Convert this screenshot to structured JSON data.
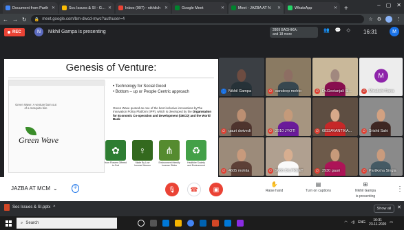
{
  "browser": {
    "tabs": [
      {
        "label": "Document from Parth",
        "color": "#4285f4",
        "active": false
      },
      {
        "label": "Soc Issues & SI - Goog",
        "color": "#fbbc04",
        "active": false
      },
      {
        "label": "Inbox (997) - nikhilch",
        "color": "#ea4335",
        "active": false
      },
      {
        "label": "Google Meet",
        "color": "#00832d",
        "active": false
      },
      {
        "label": "Meet - JAZBA AT N",
        "color": "#00832d",
        "active": true
      },
      {
        "label": "WhatsApp",
        "color": "#25d366",
        "active": false
      }
    ],
    "new_tab": "+",
    "url": "meet.google.com/bm-dwcd-mwc?authuser=4"
  },
  "meet_header": {
    "rec_label": "REC",
    "presenter_initial": "N",
    "presenter_text": "Nikhil Gampa is presenting",
    "notify_line1": "2809 BAGHIKA:",
    "notify_line2": "and 18 more",
    "clock": "16:31",
    "me_initial": "M"
  },
  "slide": {
    "title": "Genesis of Venture:",
    "leaflet_tagline": "Green Wave: A venture born out of a mosquito bite",
    "leaflet_logo": "Green Wave",
    "bullets": [
      "Technology for Social Good",
      "Bottom – up or People Centric approach"
    ],
    "paragraph_pre": "Green Wave quoted as one of the best inclusive innovations byThe Innovation Policy Platform (IPP), which is developed by the ",
    "paragraph_bold": "Organisation for Economic Co-operation and Development (OECD) and the World Bank",
    "icons": [
      {
        "caption": "from Flowers Offered to God",
        "color": "#2e7d32",
        "glyph": "✿"
      },
      {
        "caption": "Made By Low Income Women",
        "color": "#33691e",
        "glyph": "♀"
      },
      {
        "caption": "Environment friendly Incense Sticks",
        "color": "#558b2f",
        "glyph": "⋔"
      },
      {
        "caption": "Healthier Society and Environment",
        "color": "#43a047",
        "glyph": "♻"
      }
    ]
  },
  "participants": [
    {
      "name": "Nikhil Gampa",
      "mic": "on",
      "bg": "#3b3f44",
      "skin": "#6d4c41",
      "cloth": "#263238"
    },
    {
      "name": "sandeep mehto",
      "mic": "off",
      "bg": "#8a7a62",
      "skin": "#8d6e63",
      "cloth": "#37474f"
    },
    {
      "name": "Dr.Geetanjali Si...",
      "mic": "off",
      "bg": "#c9b89a",
      "skin": "#a1887f",
      "cloth": "#880e4f"
    },
    {
      "name": "Minakshi Rana",
      "mic": "off",
      "bg": "#ededed",
      "avatar": "M"
    },
    {
      "name": "gauri dwivedi",
      "mic": "off",
      "bg": "#7d6b5d",
      "skin": "#bc8f72",
      "cloth": "#4e342e"
    },
    {
      "name": "2910 JYOTI",
      "mic": "off",
      "bg": "#a69580",
      "skin": "#c49a7a",
      "cloth": "#6a1b9a"
    },
    {
      "name": "6833AVANTIKA...",
      "mic": "off",
      "bg": "#5e4e42",
      "skin": "#d7a98a",
      "cloth": "#c62828"
    },
    {
      "name": "Srishti Sahi",
      "mic": "off",
      "bg": "#8c8c8c",
      "skin": "#d2a181",
      "cloth": "#3e2723"
    },
    {
      "name": "4605 mohita",
      "mic": "off",
      "bg": "#9c8b7a",
      "skin": "#c89a7c",
      "cloth": "#5d4037"
    },
    {
      "name": "9666 DILPREET",
      "mic": "off",
      "bg": "#b0a090",
      "skin": "#d7ae90",
      "cloth": "#fafafa"
    },
    {
      "name": "2930 gauri",
      "mic": "off",
      "bg": "#6d5a4a",
      "skin": "#c79a7a",
      "cloth": "#ad1457"
    },
    {
      "name": "Partiksha Singla",
      "mic": "off",
      "bg": "#8a8a8a",
      "skin": "#c99b7d",
      "cloth": "#455a64"
    }
  ],
  "controls": {
    "meeting_title": "JAZBA AT MCM",
    "meeting_chevron": "⌄",
    "raise_hand": "Raise hand",
    "captions": "Turn on captions",
    "present_line1": "Nikhil Gampa",
    "present_line2": "is presenting",
    "more": "⋮"
  },
  "downloads": {
    "file": "Soc Issues & SI.pptx",
    "show_all": "Show all"
  },
  "taskbar": {
    "search_placeholder": "Search",
    "time": "16:31",
    "date": "23-11-2020",
    "lang": "ENG"
  }
}
